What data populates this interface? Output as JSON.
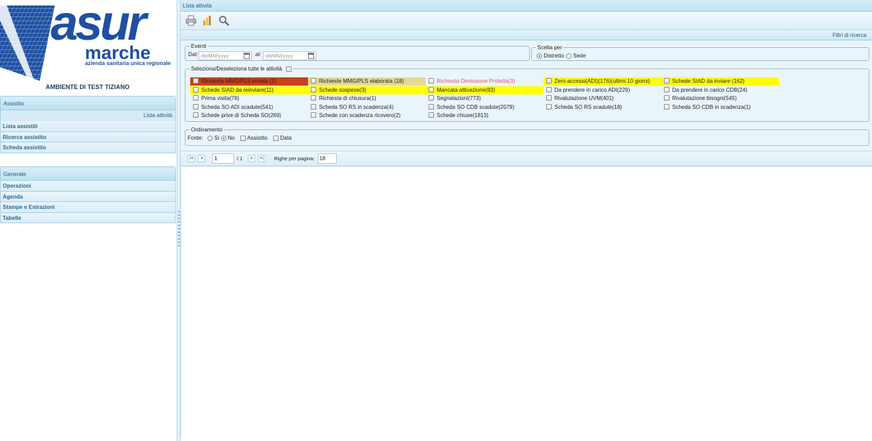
{
  "logo": {
    "brand_big": "asur",
    "brand_name": "marche",
    "brand_tagline": "azienda sanitaria unica regionale"
  },
  "env_title": "AMBIENTE DI TEST TIZIANO",
  "sidebar": {
    "assistito": {
      "header": "Assistito",
      "selected": "Lista attività",
      "items": [
        "Lista assistiti",
        "Ricerca assistito",
        "Scheda assistito"
      ]
    },
    "generale": {
      "header": "Generale",
      "items": [
        "Operazioni",
        "Agenda",
        "Stampe e Estrazioni",
        "Tabelle"
      ]
    }
  },
  "main": {
    "title": "Lista attività",
    "toolbar": {
      "icons": [
        "printer-icon",
        "export-icon",
        "search-icon"
      ]
    },
    "filter_link": "Filtri di ricerca",
    "eventi": {
      "legend": "Eventi",
      "dal_label": "Dal:",
      "al_label": "al:",
      "dal_placeholder": "dd/MM/yyyy",
      "al_placeholder": "dd/MM/yyyy"
    },
    "scelta": {
      "legend": "Scelta per",
      "options": [
        "Distretto",
        "Sede"
      ],
      "selected": "Distretto"
    },
    "attivita": {
      "legend": "Seleziona/Deseleziona tutte le attività",
      "items": [
        [
          "Richiesta MMG/PLS inviata (2)",
          "Richieste MMG/PLS elaborata (18)",
          "Richiesta Dimissione Protetta(3)",
          "Zero accessi(ADI)(176)(ultimi 10 giorni)",
          "Schede SIAD da inviare (162)"
        ],
        [
          "Schede SIAD da reinviare(11)",
          "Schede sospese(3)",
          "Mancata attivazione(83)",
          "Da prendere in carico ADI(229)",
          "Da prendere in carico CDB(24)"
        ],
        [
          "Prima visita(76)",
          "Richiesta di chiusura(1)",
          "Segnalazioni(773)",
          "Rivalutazione UVM(401)",
          "Rivalutazione bisogni(545)"
        ],
        [
          "Scheda SO ADI scadute(541)",
          "Scheda SO RS in scadenza(4)",
          "Scheda SO CDB scadute(2079)",
          "Scheda SO RS scadute(18)",
          "Scheda SO CDB in scadenza(1)"
        ],
        [
          "Schede prive di Scheda SO(269)",
          "Schede con scadenza ricovero(2)",
          "Schede chiuse(1813)"
        ]
      ],
      "highlight_colors": {
        "red": "#c8401c",
        "tan": "#e6d89a",
        "yellow": "#ffff00",
        "pink_text": "#e0506b"
      }
    },
    "ordinamento": {
      "legend": "Ordinamento",
      "fonte_label": "Fonte:",
      "fonte_options": [
        "Si",
        "No"
      ],
      "fonte_selected": "No",
      "extra": [
        "Assistito",
        "Data"
      ]
    },
    "pager": {
      "page": "1",
      "of": "/ 1",
      "rows_label": "Righe per pagina:",
      "rows_value": "18"
    }
  }
}
